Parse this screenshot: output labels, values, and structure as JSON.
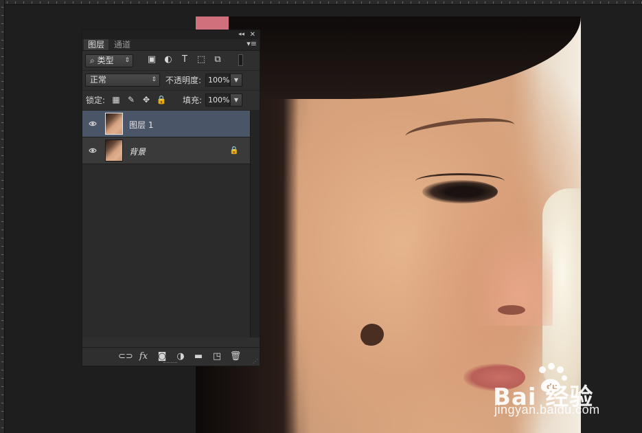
{
  "panel": {
    "collapse_glyph": "◂◂",
    "close_glyph": "✕",
    "menu_glyph": "▾≡",
    "tabs": [
      {
        "label": "图层"
      },
      {
        "label": "通道"
      }
    ],
    "filter": {
      "kind_label": "类型",
      "search_glyph": "⌕",
      "arrows": "⇕",
      "icons": [
        {
          "name": "image-filter-icon",
          "glyph": "▣"
        },
        {
          "name": "adjustment-filter-icon",
          "glyph": "◐"
        },
        {
          "name": "type-filter-icon",
          "glyph": "T"
        },
        {
          "name": "shape-filter-icon",
          "glyph": "⬚"
        },
        {
          "name": "smart-object-filter-icon",
          "glyph": "⧉"
        }
      ]
    },
    "blend": {
      "mode_label": "正常",
      "opacity_label": "不透明度:",
      "opacity_value": "100%"
    },
    "lock": {
      "label": "锁定:",
      "icons": [
        {
          "name": "lock-transparent-icon",
          "glyph": "▦"
        },
        {
          "name": "lock-image-icon",
          "glyph": "✎"
        },
        {
          "name": "lock-position-icon",
          "glyph": "✥"
        },
        {
          "name": "lock-all-icon",
          "glyph": "🔒"
        }
      ],
      "fill_label": "填充:",
      "fill_value": "100%"
    },
    "layers": [
      {
        "name": "图层 1",
        "selected": true,
        "locked": false
      },
      {
        "name": "背景",
        "selected": false,
        "locked": true
      }
    ],
    "bottom_icons": [
      {
        "name": "link-layers-icon",
        "glyph": "⊂⊃"
      },
      {
        "name": "fx-icon",
        "glyph": "fx"
      },
      {
        "name": "add-mask-icon",
        "glyph": "◙"
      },
      {
        "name": "new-adjustment-icon",
        "glyph": "◑"
      },
      {
        "name": "new-group-icon",
        "glyph": "▬"
      },
      {
        "name": "new-layer-icon",
        "glyph": "◳"
      },
      {
        "name": "delete-layer-icon",
        "glyph": "🗑"
      }
    ],
    "lock_glyph": "🔒"
  },
  "watermark": {
    "brand": "Bai  经验",
    "url": "jingyan.baidu.com"
  },
  "colors": {
    "panel_bg": "#2f2f2f",
    "selected_layer": "#4b5568",
    "workspace": "#1e1e1e"
  }
}
